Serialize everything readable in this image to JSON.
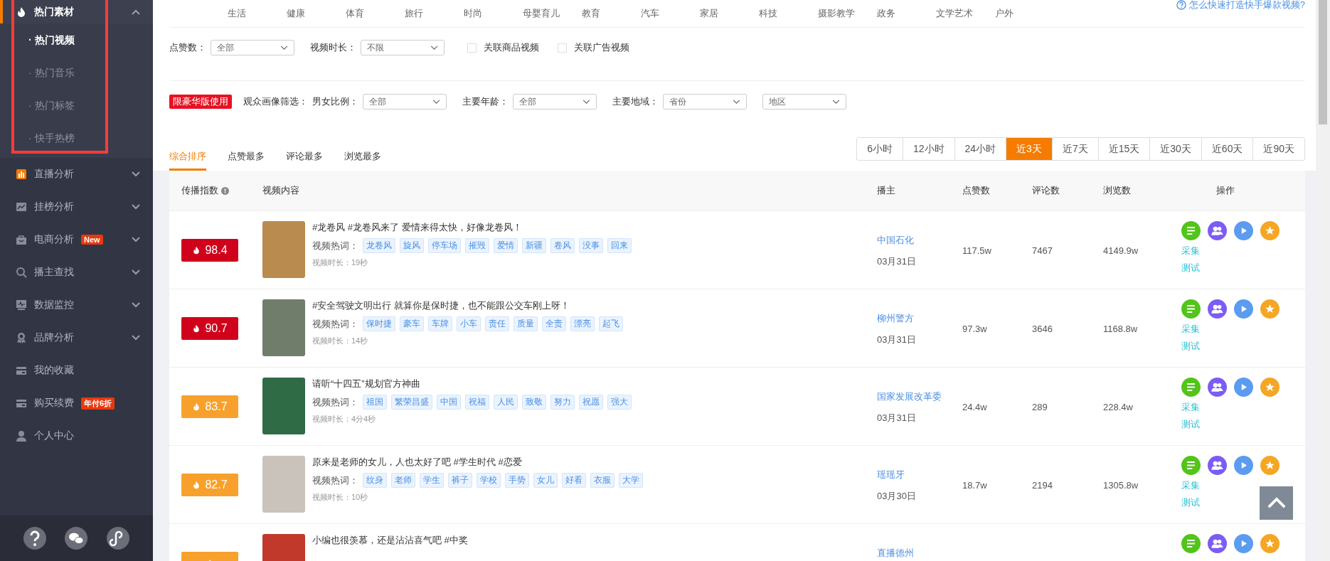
{
  "sidebar": {
    "items": [
      {
        "kind": "group",
        "label": "热门素材",
        "expanded": true,
        "selected": true,
        "children": [
          {
            "label": "· 热门视频",
            "selected": true
          },
          {
            "label": "· 热门音乐",
            "selected": false
          },
          {
            "label": "· 热门标签",
            "selected": false
          },
          {
            "label": "· 快手热榜",
            "selected": false
          }
        ]
      },
      {
        "kind": "group",
        "label": "直播分析",
        "expanded": false,
        "selected": false
      },
      {
        "kind": "group",
        "label": "挂榜分析",
        "expanded": false,
        "selected": false
      },
      {
        "kind": "group",
        "label": "电商分析",
        "expanded": false,
        "selected": false,
        "badge": "New"
      },
      {
        "kind": "group",
        "label": "播主查找",
        "expanded": false,
        "selected": false
      },
      {
        "kind": "group",
        "label": "数据监控",
        "expanded": false,
        "selected": false
      },
      {
        "kind": "group",
        "label": "品牌分析",
        "expanded": false,
        "selected": false
      },
      {
        "kind": "link",
        "label": "我的收藏",
        "selected": false
      },
      {
        "kind": "link",
        "label": "购买续费",
        "selected": false,
        "badge": "年付6折"
      },
      {
        "kind": "link",
        "label": "个人中心",
        "selected": false
      }
    ]
  },
  "categories": [
    "生活",
    "健康",
    "体育",
    "旅行",
    "时尚",
    "母婴育儿",
    "教育",
    "汽车",
    "家居",
    "科技",
    "摄影教学",
    "政务",
    "文学艺术",
    "户外"
  ],
  "help_link": "怎么快速打造快手爆款视频?",
  "filters": {
    "selects": [
      {
        "label": "点赞数：",
        "value": "全部"
      },
      {
        "label": "视频时长：",
        "value": "不限"
      }
    ],
    "checkboxes": [
      {
        "label": "关联商品视频",
        "checked": false
      },
      {
        "label": "关联广告视频",
        "checked": false
      }
    ]
  },
  "audience": {
    "tag": "限豪华版使用",
    "title": "观众画像筛选：",
    "selects": [
      {
        "label": "男女比例：",
        "value": "全部"
      },
      {
        "label": "主要年龄：",
        "value": "全部"
      },
      {
        "label": "主要地域：",
        "value": "省份"
      },
      {
        "value": "地区"
      }
    ]
  },
  "sort_tabs": [
    {
      "label": "综合排序",
      "selected": true
    },
    {
      "label": "点赞最多",
      "selected": false
    },
    {
      "label": "评论最多",
      "selected": false
    },
    {
      "label": "浏览最多",
      "selected": false
    }
  ],
  "time_ranges": [
    {
      "label": "6小时",
      "selected": false
    },
    {
      "label": "12小时",
      "selected": false
    },
    {
      "label": "24小时",
      "selected": false
    },
    {
      "label": "近3天",
      "selected": true
    },
    {
      "label": "近7天",
      "selected": false
    },
    {
      "label": "近15天",
      "selected": false
    },
    {
      "label": "近30天",
      "selected": false
    },
    {
      "label": "近60天",
      "selected": false
    },
    {
      "label": "近90天",
      "selected": false
    }
  ],
  "table": {
    "columns": [
      "传播指数",
      "视频内容",
      "播主",
      "点赞数",
      "评论数",
      "浏览数",
      "操作"
    ],
    "rows": [
      {
        "score": "98.4",
        "color": "#d0021b",
        "title": "#龙卷风 #龙卷风来了 爱情来得太快，好像龙卷风！",
        "tags_label": "视频热词：",
        "tags": [
          "龙卷风",
          "旋风",
          "停车场",
          "摧毁",
          "爱情",
          "新疆",
          "卷风",
          "没事",
          "回来"
        ],
        "duration": "视频时长：19秒",
        "host": "中国石化",
        "date": "03月31日",
        "likes": "117.5w",
        "comments": "7467",
        "views": "4149.9w",
        "actions": [
          "采集",
          "测试"
        ]
      },
      {
        "score": "90.7",
        "color": "#d0021b",
        "title": "#安全驾驶文明出行 就算你是保时捷，也不能跟公交车刚上呀！",
        "tags_label": "视频热词：",
        "tags": [
          "保时捷",
          "豪车",
          "车牌",
          "小车",
          "责任",
          "质量",
          "全责",
          "漂亮",
          "起飞"
        ],
        "duration": "视频时长：14秒",
        "host": "柳州警方",
        "date": "03月31日",
        "likes": "97.3w",
        "comments": "3646",
        "views": "1168.8w",
        "actions": [
          "采集",
          "测试"
        ]
      },
      {
        "score": "83.7",
        "color": "#f7a12c",
        "title": "请听“十四五”规划官方神曲",
        "tags_label": "视频热词：",
        "tags": [
          "祖国",
          "繁荣昌盛",
          "中国",
          "祝福",
          "人民",
          "致敬",
          "努力",
          "祝愿",
          "强大"
        ],
        "duration": "视频时长：4分4秒",
        "host": "国家发展改革委",
        "date": "03月31日",
        "likes": "24.4w",
        "comments": "289",
        "views": "228.4w",
        "actions": [
          "采集",
          "测试"
        ]
      },
      {
        "score": "82.7",
        "color": "#f7a12c",
        "title": "原来是老师的女儿，人也太好了吧 #学生时代 #恋爱",
        "tags_label": "视频热词：",
        "tags": [
          "纹身",
          "老师",
          "学生",
          "裤子",
          "学校",
          "手势",
          "女儿",
          "好看",
          "衣服",
          "大学"
        ],
        "duration": "视频时长：10秒",
        "host": "瑶瑶牙",
        "date": "03月30日",
        "likes": "18.7w",
        "comments": "2194",
        "views": "1305.8w",
        "actions": [
          "采集",
          "测试"
        ]
      },
      {
        "color": "#f7a12c",
        "title": "小编也很羡慕，还是沾沾喜气吧 #中奖",
        "host": "直播德州"
      }
    ]
  }
}
